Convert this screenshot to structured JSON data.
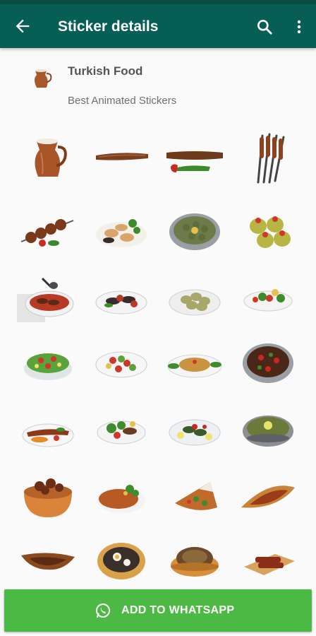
{
  "appbar": {
    "title": "Sticker details",
    "back_icon": "arrow-back-icon",
    "search_icon": "search-icon",
    "more_icon": "more-vert-icon",
    "color": "#075e54"
  },
  "pack": {
    "name": "Turkish Food",
    "publisher": "Best Animated Stickers",
    "tray_icon": "copper-jug-icon"
  },
  "stickers": [
    {
      "name": "copper-jug-sticker"
    },
    {
      "name": "single-kebab-sticker"
    },
    {
      "name": "kebab-with-pepper-sticker"
    },
    {
      "name": "skewers-sticker"
    },
    {
      "name": "shish-kebab-sticker"
    },
    {
      "name": "mussels-sticker"
    },
    {
      "name": "round-tray-sticker"
    },
    {
      "name": "stuffed-peppers-sticker"
    },
    {
      "name": "kebab-plate-sticker"
    },
    {
      "name": "eggplant-plate-sticker"
    },
    {
      "name": "dolma-plate-sticker"
    },
    {
      "name": "salad-plate-sticker"
    },
    {
      "name": "green-salad-sticker"
    },
    {
      "name": "shepherd-salad-sticker"
    },
    {
      "name": "bulgur-salad-sticker"
    },
    {
      "name": "kebab-platter-sticker"
    },
    {
      "name": "adana-plate-sticker"
    },
    {
      "name": "iskender-plate-sticker"
    },
    {
      "name": "sarma-plate-sticker"
    },
    {
      "name": "lentil-soup-sticker"
    },
    {
      "name": "clay-pot-sticker"
    },
    {
      "name": "lahmacun-sticker"
    },
    {
      "name": "lahmacun-slice-sticker"
    },
    {
      "name": "pide-sticker"
    },
    {
      "name": "boat-pide-sticker"
    },
    {
      "name": "egg-pizza-sticker"
    },
    {
      "name": "round-pide-sticker"
    },
    {
      "name": "kebab-board-sticker"
    }
  ],
  "footer": {
    "button_label": "ADD TO WHATSAPP",
    "icon": "whatsapp-icon",
    "color": "#4cb944"
  }
}
